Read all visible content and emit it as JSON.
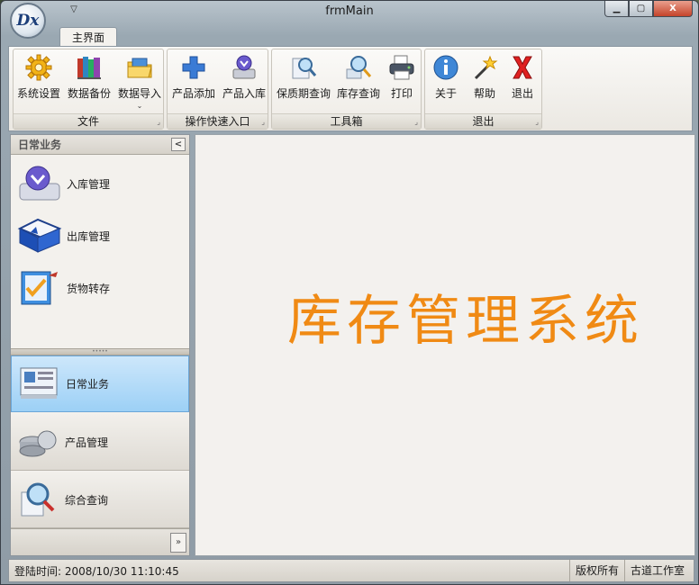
{
  "window": {
    "title": "frmMain",
    "logo_text": "Dx",
    "quick_access": "▽"
  },
  "window_buttons": {
    "minimize": "▁",
    "maximize": "▢",
    "close": "X"
  },
  "ribbon": {
    "tab": "主界面",
    "groups": [
      {
        "label": "文件",
        "buttons": [
          "系统设置",
          "数据备份",
          "数据导入"
        ]
      },
      {
        "label": "操作快速入口",
        "buttons": [
          "产品添加",
          "产品入库"
        ]
      },
      {
        "label": "工具箱",
        "buttons": [
          "保质期查询",
          "库存查询",
          "打印"
        ]
      },
      {
        "label": "退出",
        "buttons": [
          "关于",
          "帮助",
          "退出"
        ]
      }
    ]
  },
  "nav": {
    "header": "日常业务",
    "collapse": "<",
    "items": [
      "入库管理",
      "出库管理",
      "货物转存"
    ],
    "splitter": "•••••",
    "groups": [
      "日常业务",
      "产品管理",
      "综合查询"
    ],
    "expand": "»"
  },
  "main": {
    "title": "库存管理系统"
  },
  "status": {
    "login_label": "登陆时间:",
    "login_time": "2008/10/30 11:10:45",
    "copyright": "版权所有",
    "studio": "古道工作室"
  },
  "colors": {
    "title_orange": "#f08a14",
    "active_group": "#9cd0f6"
  }
}
